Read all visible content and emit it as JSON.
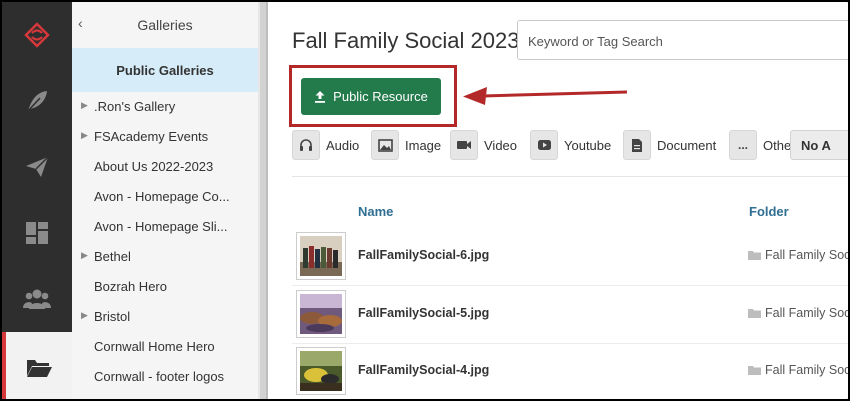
{
  "sidebar_rail": {
    "items": [
      {
        "icon": "brand-logo-icon"
      },
      {
        "icon": "feather-icon"
      },
      {
        "icon": "paper-plane-icon"
      },
      {
        "icon": "dashboard-icon"
      },
      {
        "icon": "users-group-icon"
      },
      {
        "icon": "folder-open-icon",
        "active": true
      }
    ],
    "accent": "#d5383b"
  },
  "gallery_panel": {
    "back": "‹",
    "title": "Galleries",
    "active_item": "Public Galleries",
    "items": [
      {
        "label": ".Ron's Gallery",
        "expandable": true
      },
      {
        "label": "FSAcademy Events",
        "expandable": true
      },
      {
        "label": "About Us 2022-2023",
        "expandable": false
      },
      {
        "label": "Avon - Homepage Co...",
        "expandable": false
      },
      {
        "label": "Avon - Homepage Sli...",
        "expandable": false
      },
      {
        "label": "Bethel",
        "expandable": true
      },
      {
        "label": "Bozrah Hero",
        "expandable": false
      },
      {
        "label": "Bristol",
        "expandable": true
      },
      {
        "label": "Cornwall Home Hero",
        "expandable": false
      },
      {
        "label": "Cornwall - footer logos",
        "expandable": false
      }
    ]
  },
  "main": {
    "title": "Fall Family Social 2023",
    "search": {
      "placeholder": "Keyword or Tag Search",
      "value": ""
    },
    "public_button": {
      "label": "Public Resource",
      "color": "#237a4b"
    },
    "highlight_color": "#b32929",
    "filters": [
      {
        "label": "Audio",
        "icon": "headphones-icon"
      },
      {
        "label": "Image",
        "icon": "image-icon"
      },
      {
        "label": "Video",
        "icon": "video-camera-icon"
      },
      {
        "label": "Youtube",
        "icon": "youtube-icon"
      },
      {
        "label": "Document",
        "icon": "document-icon"
      },
      {
        "label": "Other",
        "icon": "ellipsis-icon",
        "glyph": "..."
      }
    ],
    "filter_more": "No A",
    "table": {
      "columns": {
        "name": "Name",
        "folder": "Folder"
      },
      "rows": [
        {
          "name": "FallFamilySocial-6.jpg",
          "folder": "Fall Family Soc"
        },
        {
          "name": "FallFamilySocial-5.jpg",
          "folder": "Fall Family Soc"
        },
        {
          "name": "FallFamilySocial-4.jpg",
          "folder": "Fall Family Soc"
        }
      ]
    }
  }
}
